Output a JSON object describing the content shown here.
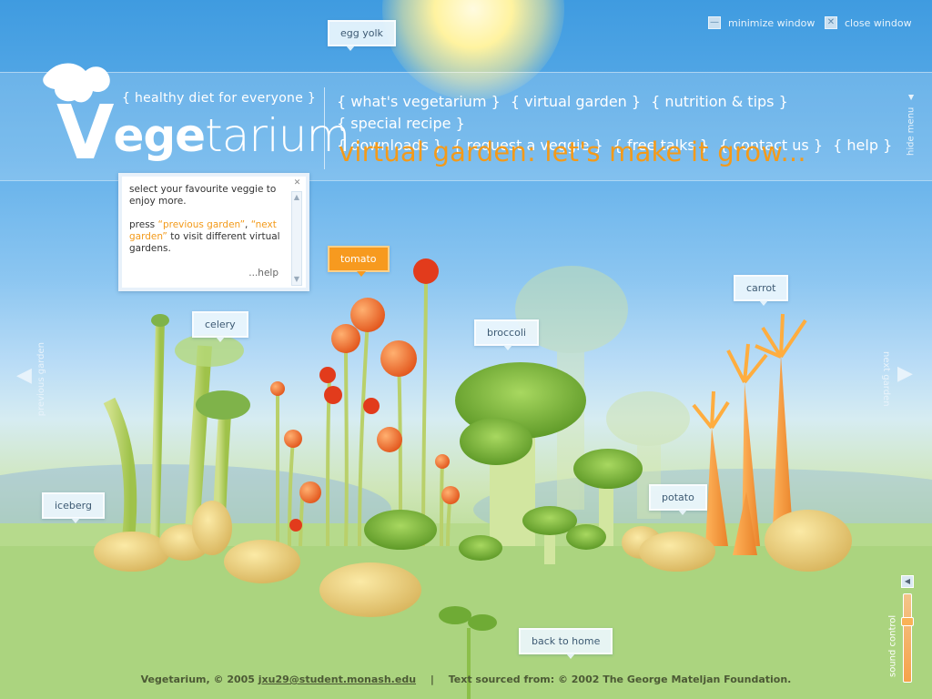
{
  "window_controls": {
    "minimize_label": "minimize window",
    "close_label": "close window"
  },
  "brand": {
    "logo_v": "V",
    "logo_ege": "ege",
    "logo_tarium": "tarium",
    "tagline": "{ healthy diet for everyone }"
  },
  "nav": {
    "items": [
      "{ what's vegetarium }",
      "{ virtual garden }",
      "{ nutrition & tips }",
      "{ special recipe }",
      "{ downloads }",
      "{ request a veggie }",
      "{ free talks }",
      "{ contact us }",
      "{ help }"
    ],
    "hide_menu": "hide menu"
  },
  "headline": "virtual garden:  let's make it grow...",
  "help_panel": {
    "line1": "select your favourite veggie to enjoy more.",
    "line2_a": "press ",
    "line2_prev": "“previous garden”",
    "line2_b": ", ",
    "line2_next": "“next garden”",
    "line2_c": " to visit different virtual gardens.",
    "more": "...help"
  },
  "veggie_tags": {
    "egg_yolk": "egg yolk",
    "tomato": "tomato",
    "celery": "celery",
    "broccoli": "broccoli",
    "carrot": "carrot",
    "iceberg": "iceberg",
    "potato": "potato"
  },
  "navigation": {
    "previous_garden": "previous garden",
    "next_garden": "next garden",
    "back_to_home": "back to home"
  },
  "footer": {
    "copyright": "Vegetarium, © 2005 ",
    "email": "jxu29@student.monash.edu",
    "separator": "|",
    "source": "Text sourced from: © 2002 The George Mateljan Foundation."
  },
  "sound": {
    "label": "sound control",
    "level": 0.3
  },
  "colors": {
    "accent": "#f39a1a",
    "sky": "#62b0ea",
    "grass": "#a6d07a"
  }
}
